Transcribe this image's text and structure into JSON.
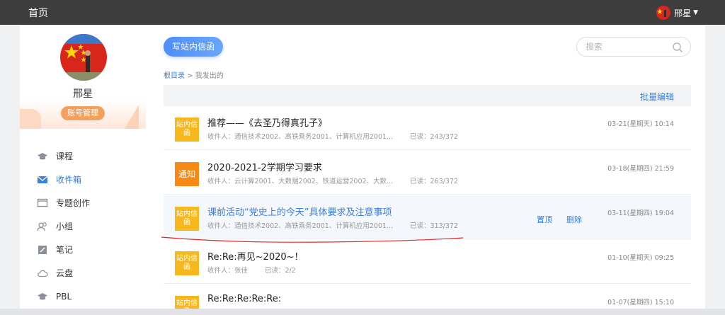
{
  "topbar": {
    "home": "首页",
    "username": "邢星"
  },
  "profile": {
    "name": "邢星",
    "account_button": "账号管理"
  },
  "nav": [
    {
      "label": "课程",
      "icon": "cap-icon"
    },
    {
      "label": "收件箱",
      "icon": "inbox-icon"
    },
    {
      "label": "专题创作",
      "icon": "window-icon"
    },
    {
      "label": "小组",
      "icon": "group-icon"
    },
    {
      "label": "笔记",
      "icon": "note-icon"
    },
    {
      "label": "云盘",
      "icon": "cloud-icon"
    },
    {
      "label": "PBL",
      "icon": "pbl-icon"
    }
  ],
  "toolbar": {
    "compose": "写站内信函",
    "search_placeholder": "搜索"
  },
  "breadcrumb": {
    "root": "根目录",
    "sep": ">",
    "current": "我发出的"
  },
  "list": {
    "batch_edit": "批量编辑"
  },
  "messages": [
    {
      "badge": "站内信函",
      "type": "letter",
      "title": "推荐——《去圣乃得真孔子》",
      "recipients": "收件人：通信技术2002、高铁乘务2001、计算机应用2001...",
      "read": "已读：243/372",
      "date": "03-21(星期天) 10:14"
    },
    {
      "badge": "通知",
      "type": "notice",
      "title": "2020-2021-2学期学习要求",
      "recipients": "收件人：云计算2001、大数据2002、铁道运营2002、大数...",
      "read": "已读：263/372",
      "date": "03-18(星期四) 21:59"
    },
    {
      "badge": "站内信函",
      "type": "letter",
      "title": "课前活动“党史上的今天”具体要求及注意事项",
      "recipients": "收件人：通信技术2002、高铁乘务2001、计算机应用2001...",
      "read": "已读：313/372",
      "date": "03-11(星期四) 19:04",
      "actions": {
        "pin": "置顶",
        "delete": "删除"
      }
    },
    {
      "badge": "站内信函",
      "type": "letter",
      "title": "Re:Re:再见~2020~！",
      "recipients": "收件人：张佳",
      "read": "已读：2/2",
      "date": "01-10(星期天) 09:25"
    },
    {
      "badge": "站内信函",
      "type": "letter",
      "title": "Re:Re:Re:Re:Re:",
      "recipients": "",
      "read": "",
      "date": "01-07(星期四) 15:10"
    }
  ],
  "colors": {
    "accent": "#3a7fe0",
    "letter_badge": "#f7b81d",
    "notice_badge": "#f68a14",
    "topbar": "#3d3d3d",
    "annotation": "#e02a2a"
  }
}
